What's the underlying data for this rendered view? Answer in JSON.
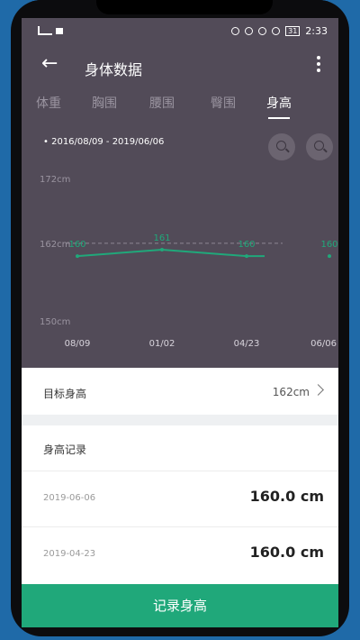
{
  "system_bar": {
    "time": "2:33",
    "battery": "31"
  },
  "appbar": {
    "title": "身体数据"
  },
  "tabs": [
    {
      "label": "体重"
    },
    {
      "label": "胸围"
    },
    {
      "label": "腰围"
    },
    {
      "label": "臀围"
    },
    {
      "label": "身高",
      "active": true
    }
  ],
  "date_range": "2016/08/09 - 2019/06/06",
  "chart_data": {
    "type": "line",
    "y_ticks": [
      "172cm",
      "162cm",
      "150cm"
    ],
    "y_tick_values": [
      172,
      162,
      150
    ],
    "ylim": [
      150,
      172
    ],
    "x_ticks": [
      "08/09",
      "01/02",
      "04/23",
      "06/06"
    ],
    "target_value": 162,
    "series": [
      {
        "values": [
          160,
          161,
          160,
          160
        ]
      }
    ],
    "point_labels": [
      "160",
      "161",
      "160",
      "160"
    ],
    "line_color": "#20a87a",
    "grid": false
  },
  "goal": {
    "label": "目标身高",
    "value": "162cm"
  },
  "records": {
    "header": "身高记录",
    "items": [
      {
        "date": "2019-06-06",
        "value": "160.0 cm"
      },
      {
        "date": "2019-04-23",
        "value": "160.0 cm"
      }
    ]
  },
  "cta": {
    "label": "记录身高"
  },
  "colors": {
    "accent": "#20a87a",
    "screen_bg": "#524b58"
  }
}
